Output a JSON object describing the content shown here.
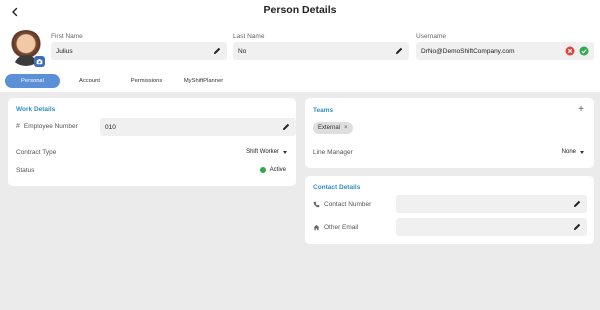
{
  "header": {
    "title": "Person Details"
  },
  "profile": {
    "first_name_label": "First Name",
    "first_name_value": "Julius",
    "last_name_label": "Last Name",
    "last_name_value": "No",
    "username_label": "Username",
    "username_value": "DrNo@DemoShiftCompany.com"
  },
  "tabs": [
    {
      "label": "Personal",
      "active": true
    },
    {
      "label": "Account",
      "active": false
    },
    {
      "label": "Permissions",
      "active": false
    },
    {
      "label": "MyShiftPlanner",
      "active": false
    }
  ],
  "work_details": {
    "title": "Work Details",
    "employee_number_label": "Employee Number",
    "employee_number_value": "010",
    "contract_type_label": "Contract Type",
    "contract_type_value": "Shift Worker",
    "status_label": "Status",
    "status_value": "Active"
  },
  "teams": {
    "title": "Teams",
    "add_label": "+",
    "chips": [
      "External"
    ],
    "line_manager_label": "Line Manager",
    "line_manager_value": "None"
  },
  "contact_details": {
    "title": "Contact Details",
    "contact_number_label": "Contact Number",
    "contact_number_value": "",
    "other_email_label": "Other Email",
    "other_email_value": ""
  },
  "colors": {
    "accent": "#5b8fd6",
    "section_title": "#2f8fbf",
    "status_active": "#2eaa4a",
    "username_cancel": "#e0453c",
    "username_confirm": "#2eaa4a"
  },
  "icons": [
    "back-arrow-icon",
    "camera-icon",
    "pencil-icon",
    "cancel-circle-icon",
    "check-circle-icon",
    "hash-icon",
    "phone-icon",
    "home-icon",
    "close-icon",
    "caret-down-icon"
  ]
}
